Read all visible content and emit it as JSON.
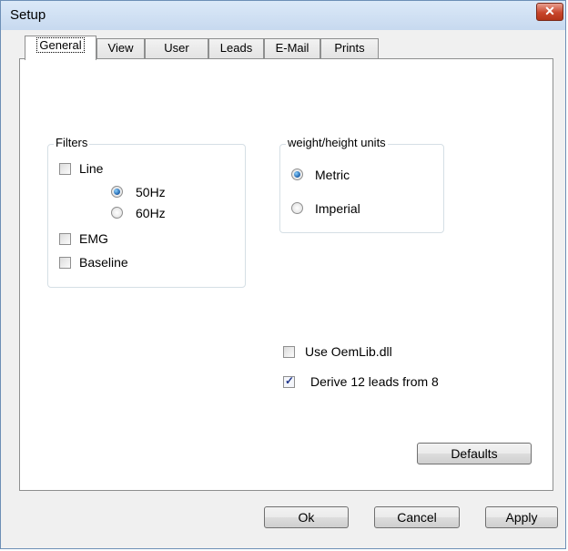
{
  "window": {
    "title": "Setup",
    "close_glyph": "✕"
  },
  "tabs": [
    {
      "label": "General"
    },
    {
      "label": "View"
    },
    {
      "label": "User"
    },
    {
      "label": "Leads"
    },
    {
      "label": "E-Mail"
    },
    {
      "label": "Prints"
    }
  ],
  "active_tab": "General",
  "filters": {
    "title": "Filters",
    "line": {
      "label": "Line",
      "checked": false
    },
    "hz50": {
      "label": "50Hz",
      "selected": true
    },
    "hz60": {
      "label": "60Hz",
      "selected": false
    },
    "emg": {
      "label": "EMG",
      "checked": false
    },
    "baseline": {
      "label": "Baseline",
      "checked": false
    }
  },
  "units": {
    "title": "weight/height units",
    "metric": {
      "label": "Metric",
      "selected": true
    },
    "imperial": {
      "label": "Imperial",
      "selected": false
    }
  },
  "options": {
    "oemlib": {
      "label": "Use OemLib.dll",
      "checked": false
    },
    "derive": {
      "label": "Derive 12 leads from 8",
      "checked": true,
      "mark": "✓"
    }
  },
  "buttons": {
    "defaults": "Defaults",
    "ok": "Ok",
    "cancel": "Cancel",
    "apply": "Apply"
  },
  "colors": {
    "title_bar": "#c7d9ef",
    "close": "#c8452b",
    "radio_dot": "#1c5fa8"
  }
}
